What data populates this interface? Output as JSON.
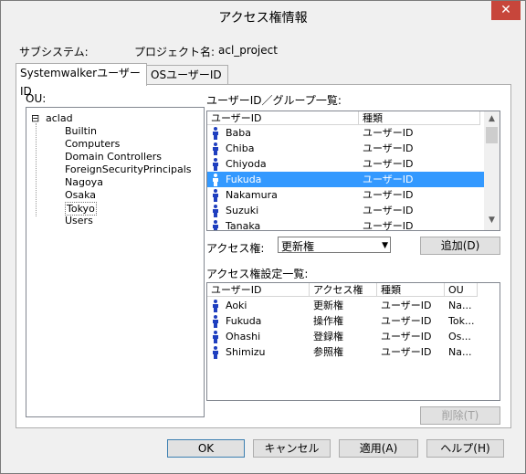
{
  "window": {
    "title": "アクセス権情報",
    "close_glyph": "✕"
  },
  "info": {
    "subsystem_label": "サブシステム:",
    "project_label": "プロジェクト名:",
    "project_value": "acl_project"
  },
  "tabs": [
    {
      "label": "SystemwalkerユーザーID"
    },
    {
      "label": "OSユーザーID"
    }
  ],
  "ou": {
    "label": "OU:",
    "root": "aclad",
    "root_toggle": "⊟",
    "children": [
      "Builtin",
      "Computers",
      "Domain Controllers",
      "ForeignSecurityPrincipals",
      "Nagoya",
      "Osaka",
      "Tokyo",
      "Users"
    ]
  },
  "user_list": {
    "label": "ユーザーID／グループ一覧:",
    "columns": [
      "ユーザーID",
      "種類"
    ],
    "rows": [
      {
        "id": "Baba",
        "type": "ユーザーID"
      },
      {
        "id": "Chiba",
        "type": "ユーザーID"
      },
      {
        "id": "Chiyoda",
        "type": "ユーザーID"
      },
      {
        "id": "Fukuda",
        "type": "ユーザーID",
        "selected": true
      },
      {
        "id": "Nakamura",
        "type": "ユーザーID"
      },
      {
        "id": "Suzuki",
        "type": "ユーザーID"
      },
      {
        "id": "Tanaka",
        "type": "ユーザーID"
      }
    ]
  },
  "access": {
    "label": "アクセス権:",
    "value": "更新権",
    "add_button": "追加(D)"
  },
  "settings_list": {
    "label": "アクセス権設定一覧:",
    "columns": [
      "ユーザーID",
      "アクセス権",
      "種類",
      "OU"
    ],
    "rows": [
      {
        "id": "Aoki",
        "right": "更新権",
        "type": "ユーザーID",
        "ou": "Na..."
      },
      {
        "id": "Fukuda",
        "right": "操作権",
        "type": "ユーザーID",
        "ou": "Tok..."
      },
      {
        "id": "Ohashi",
        "right": "登録権",
        "type": "ユーザーID",
        "ou": "Os..."
      },
      {
        "id": "Shimizu",
        "right": "参照権",
        "type": "ユーザーID",
        "ou": "Na..."
      }
    ],
    "delete_button": "削除(T)"
  },
  "footer": {
    "ok": "OK",
    "cancel": "キャンセル",
    "apply": "適用(A)",
    "help": "ヘルプ(H)"
  },
  "colors": {
    "selection": "#3399ff",
    "person_icon": "#1f3fbf",
    "close_button": "#c7463b"
  }
}
